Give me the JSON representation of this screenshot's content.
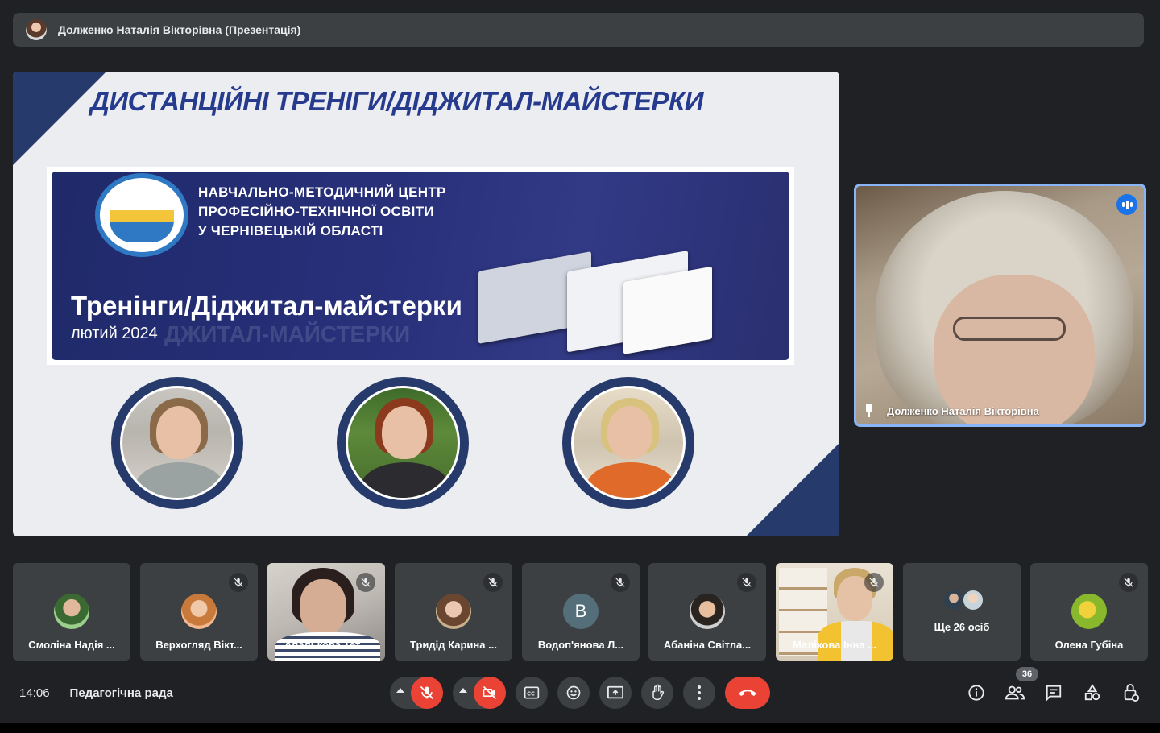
{
  "presenter_bar": {
    "title": "Долженко Наталія Вікторівна (Презентація)"
  },
  "slide": {
    "header": "ДИСТАНЦІЙНІ ТРЕНІГИ/ДІДЖИТАЛ-МАЙСТЕРКИ",
    "org_lines": [
      "НАВЧАЛЬНО-МЕТОДИЧНИЙ ЦЕНТР",
      "ПРОФЕСІЙНО-ТЕХНІЧНОЇ ОСВІТИ",
      "У ЧЕРНІВЕЦЬКІЙ ОБЛАСТІ"
    ],
    "banner_title": "Тренінги/Діджитал-майстерки",
    "banner_subtitle": "лютий 2024",
    "banner_ghost_text": "ДЖИТАЛ-МАЙСТЕРКИ",
    "accent_color": "#263a6b",
    "header_color": "#263a8e"
  },
  "speaker": {
    "name": "Долженко Наталія Вікторівна",
    "pin_icon": "pin-icon",
    "speaking_icon": "audio-level-icon"
  },
  "participants": [
    {
      "name": "Смоліна Надія ...",
      "muted": false
    },
    {
      "name": "Верхогляд Вікт...",
      "muted": true
    },
    {
      "name": "Апалькова Тет...",
      "muted": true
    },
    {
      "name": "Тридід Карина ...",
      "muted": true
    },
    {
      "name": "Водоп'янова Л...",
      "muted": true,
      "letter": "B"
    },
    {
      "name": "Абаніна Світла...",
      "muted": true
    },
    {
      "name": "Малікова Інна ...",
      "muted": true
    },
    {
      "name": "Ще 26 осіб",
      "muted": false
    },
    {
      "name": "Олена Губіна",
      "muted": true
    }
  ],
  "footer": {
    "time": "14:06",
    "meeting_name": "Педагогічна рада",
    "participant_count": "36"
  },
  "controls": {
    "mic": "mic-off-icon",
    "camera": "camera-off-icon",
    "captions": "captions-icon",
    "reactions": "emoji-icon",
    "present": "present-screen-icon",
    "raise_hand": "raise-hand-icon",
    "more": "more-options-icon",
    "leave": "leave-call-icon",
    "info": "info-icon",
    "people": "people-icon",
    "chat": "chat-icon",
    "activities": "activities-icon",
    "host_controls": "host-controls-icon",
    "leave_color": "#ea4335",
    "off_color": "#ea4335"
  }
}
